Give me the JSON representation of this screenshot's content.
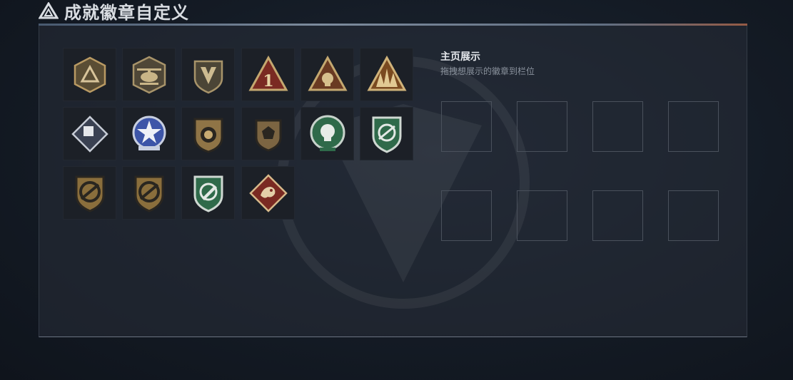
{
  "header": {
    "title": "成就徽章自定义"
  },
  "badge_grid": {
    "items": [
      {
        "icon": "shield-triangle-badge-icon"
      },
      {
        "icon": "helicopter-badge-icon"
      },
      {
        "icon": "winged-shield-badge-icon"
      },
      {
        "icon": "red-triangle-number-one-badge-icon"
      },
      {
        "icon": "triangle-skull-badge-icon"
      },
      {
        "icon": "triangle-soldiers-badge-icon"
      },
      {
        "icon": "diamond-crate-badge-icon"
      },
      {
        "icon": "blue-star-medal-badge-icon"
      },
      {
        "icon": "bronze-emblem-shield-badge-icon"
      },
      {
        "icon": "bronze-pentagon-shield-badge-icon"
      },
      {
        "icon": "green-skull-round-badge-icon"
      },
      {
        "icon": "green-rifle-shield-badge-icon"
      },
      {
        "icon": "gold-rifle-shield-badge-icon"
      },
      {
        "icon": "gold-rifle-shield-badge-icon"
      },
      {
        "icon": "green-rocket-shield-badge-icon"
      },
      {
        "icon": "red-dragon-diamond-badge-icon"
      }
    ]
  },
  "showcase": {
    "title": "主页展示",
    "hint": "拖拽想展示的徽章到栏位",
    "slot_count": 8
  },
  "colors": {
    "gold": "#b99a63",
    "bronze": "#8f7446",
    "green": "#2f6a4a",
    "red": "#7a2a22",
    "blue": "#5970b8"
  }
}
